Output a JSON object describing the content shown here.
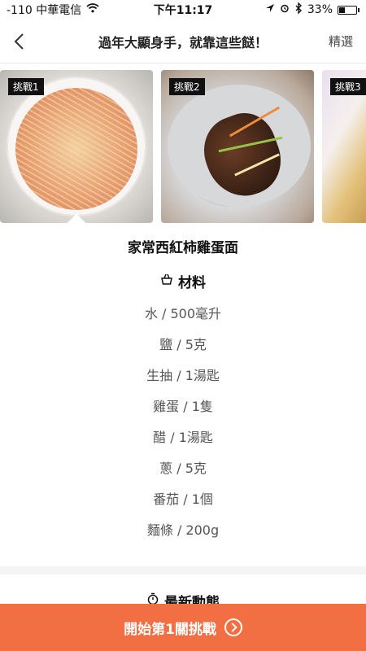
{
  "status_bar": {
    "carrier": "-110 中華電信",
    "time": "下午11:17",
    "battery": "33%",
    "battery_level": 0.33
  },
  "nav": {
    "title": "過年大顯身手，就靠這些餸！",
    "right_label": "精選"
  },
  "cards": [
    {
      "badge": "挑戰1"
    },
    {
      "badge": "挑戰2"
    },
    {
      "badge": "挑戰3"
    }
  ],
  "dish": {
    "title": "家常西紅柿雞蛋面",
    "ingredients_heading": "材料",
    "ingredients": [
      "水 / 500毫升",
      "鹽 / 5克",
      "生抽 / 1湯匙",
      "雞蛋 / 1隻",
      "醋 / 1湯匙",
      "蔥 / 5克",
      "番茄 / 1個",
      "麵條 / 200g"
    ]
  },
  "updates": {
    "heading": "最新動態"
  },
  "cta": {
    "label": "開始第1關挑戰"
  },
  "colors": {
    "accent": "#f26f43"
  }
}
